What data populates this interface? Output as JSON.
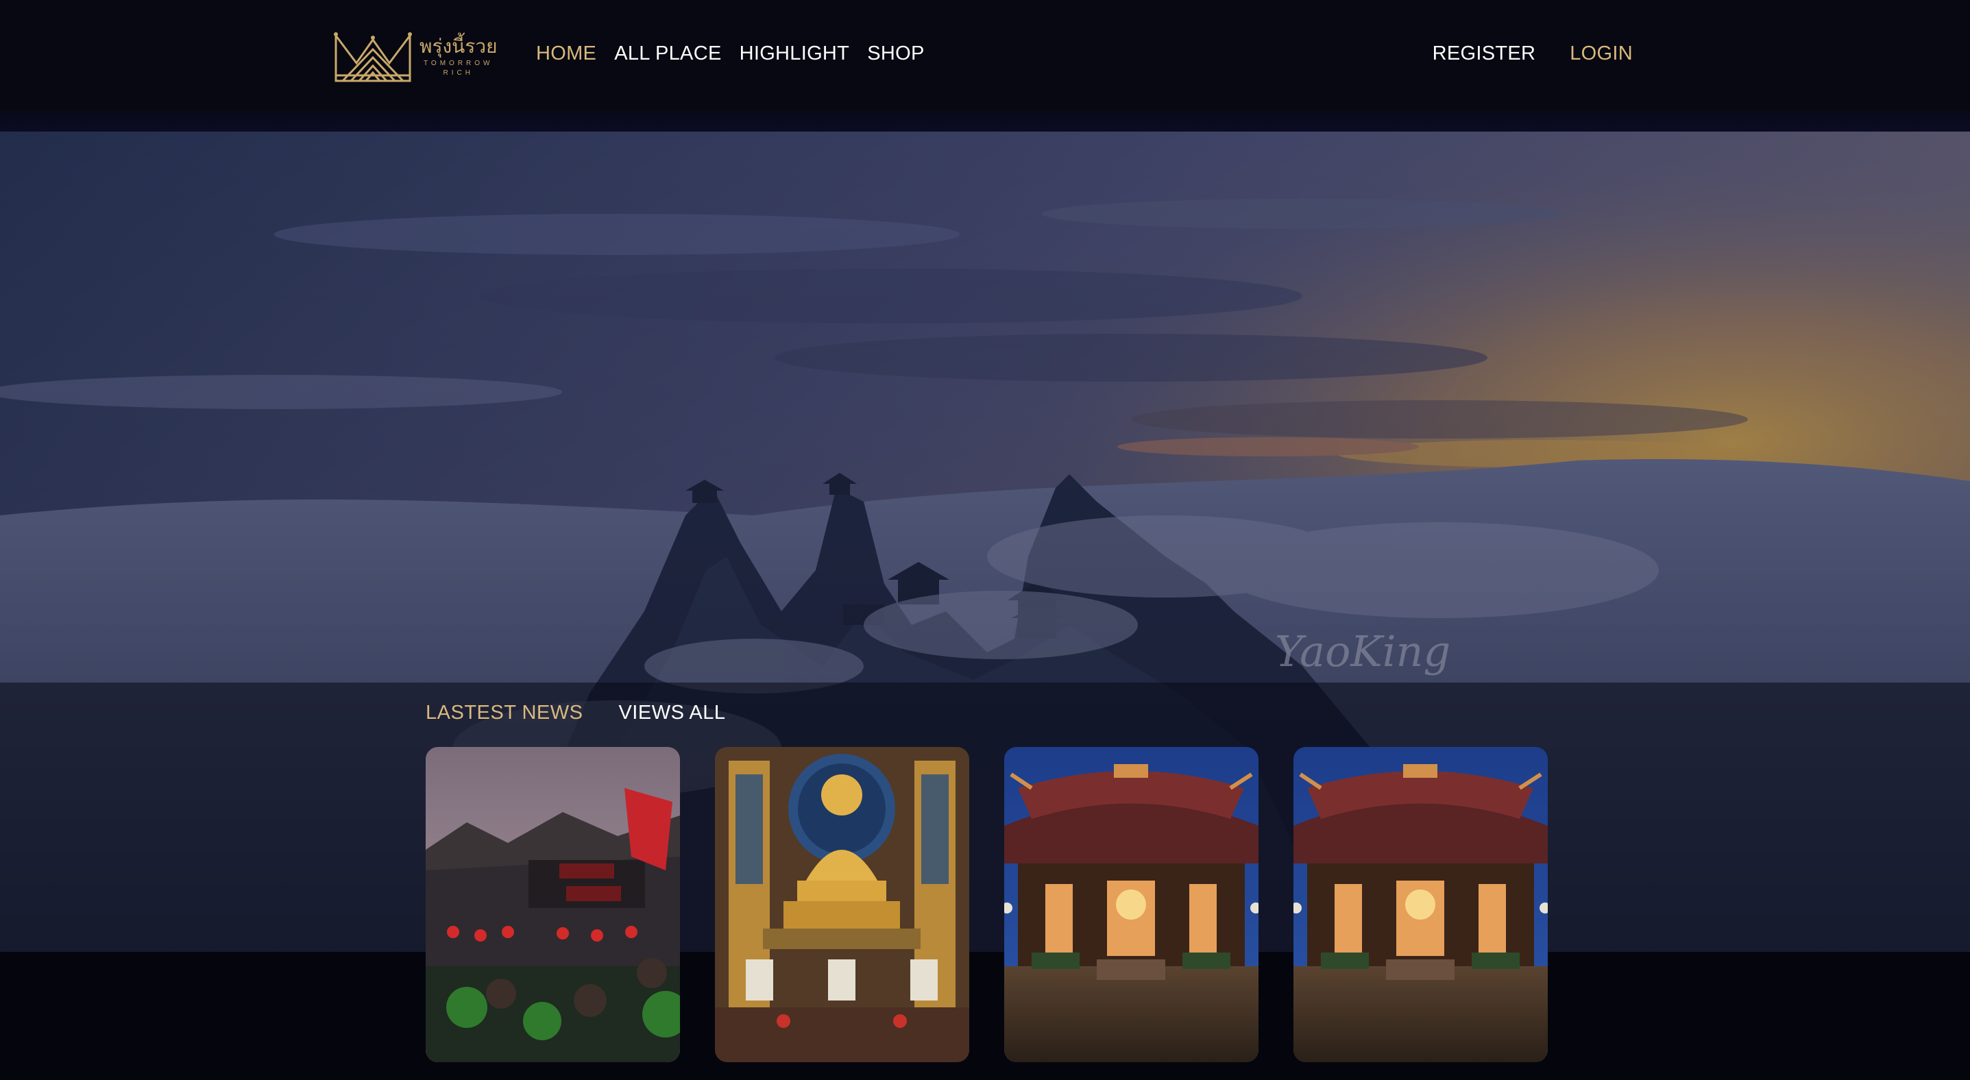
{
  "brand": {
    "name_thai": "พรุ่งนี้รวย",
    "name_line1": "TOMORROW",
    "name_line2": "RICH",
    "icon": "crown-logo-icon",
    "color": "#c9a86a"
  },
  "nav": {
    "items": [
      {
        "label": "HOME",
        "active": true
      },
      {
        "label": "ALL PLACE",
        "active": false
      },
      {
        "label": "HIGHLIGHT",
        "active": false
      },
      {
        "label": "SHOP",
        "active": false
      }
    ],
    "register_label": "REGISTER",
    "login_label": "LOGIN",
    "accent_color": "#d9b97d"
  },
  "hero": {
    "image": "mountain-temples-above-clouds-at-sunset",
    "signature": "YaoKing"
  },
  "news": {
    "title": "LASTEST NEWS",
    "view_all_label": "VIEWS ALL",
    "cards": [
      {
        "image": "chinese-temple-festival-crowd"
      },
      {
        "image": "golden-buddha-shrine"
      },
      {
        "image": "chinese-temple-at-night"
      },
      {
        "image": "chinese-temple-at-night"
      }
    ]
  }
}
